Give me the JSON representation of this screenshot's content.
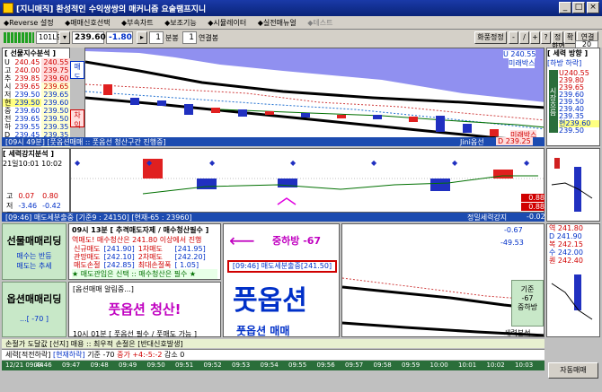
{
  "window": {
    "title": "[지니매직] 환성적인 수익쌍쌍의 매커니즘 요술램프지니"
  },
  "menu": [
    "◆Reverse 설정",
    "◆매매신호선택",
    "◆부속차트",
    "◆보조기능",
    "◆시뮬레이터",
    "◆실전매뉴얼",
    "◆테스트"
  ],
  "toolbar": {
    "code": "101L9",
    "price": "239.60",
    "change": "-1.80",
    "interval": "1",
    "interval_unit": "분봉",
    "count": "1",
    "count_unit": "연결봉",
    "right_buttons": [
      "화풍정정",
      "-",
      "/",
      "+",
      "?",
      "정",
      "확",
      "연결"
    ],
    "screen_label": "화면",
    "screen_num": "20",
    "sub_value": "239.197"
  },
  "futures": {
    "header": "[ 선물지수분석 ]",
    "rows": [
      [
        "U",
        "240.45",
        "240.55"
      ],
      [
        "고",
        "240.00",
        "239.75"
      ],
      [
        "추",
        "239.85",
        "239.60"
      ],
      [
        "시",
        "239.65",
        "239.65"
      ],
      [
        "저",
        "239.50",
        "239.65"
      ],
      [
        "현",
        "239.50",
        "239.60"
      ],
      [
        "중",
        "239.60",
        "239.50"
      ],
      [
        "전",
        "239.65",
        "239.50"
      ],
      [
        "하",
        "239.55",
        "239.35"
      ],
      [
        "D",
        "239.45",
        "239.35"
      ],
      [
        "폭",
        "1.27",
        "1.28"
      ]
    ],
    "side_a": "매",
    "side_b": "도",
    "side_c": "차",
    "side_d": "익"
  },
  "main_chart": {
    "status": "[09시 49분] [풋옵션매매 :: 풋옵선 청산구간 진행중]",
    "right_label": "Jini옵선",
    "right_value": "D 239.25",
    "tag_top": "U 240.55",
    "tag_top2": "미래박스",
    "tag_bot": "미래박스"
  },
  "sub_chart": {
    "header": "[ 세력강지분석 ]",
    "time": "21일10:01",
    "time2": "10:02",
    "rows": [
      [
        "고",
        "0.07",
        "0.80"
      ],
      [
        "저",
        "-3.46",
        "-0.42"
      ],
      [
        "중",
        "-1.00",
        "-0.80"
      ]
    ],
    "status": "[09:46] 매도세분출중 [기준9 : 24150] [현재-65 : 23960]",
    "right_label": "정밀세력강지",
    "right_val1": "0.88",
    "right_val2": "0.88",
    "right_val3": "-0.02"
  },
  "right_panel": {
    "header": "[ 세력 방향 ]",
    "sub": "[하방 하락]",
    "rows": [
      [
        "U",
        "240.55"
      ],
      [
        "",
        "239.80"
      ],
      [
        "",
        "239.65"
      ],
      [
        "",
        "239.60"
      ],
      [
        "",
        "239.50"
      ],
      [
        "",
        "239.40"
      ],
      [
        "",
        "239.35"
      ],
      [
        "현",
        "239.60"
      ],
      [
        "",
        "239.50"
      ]
    ],
    "vlabel": "시장흐름",
    "rows2": [
      [
        "역",
        "241.80"
      ],
      [
        "D",
        "241.90"
      ],
      [
        "복",
        "242.15"
      ],
      [
        "수",
        "242.00"
      ],
      [
        "퀀",
        "242.40"
      ]
    ]
  },
  "signal": {
    "left_title": "선물매매리딩",
    "left_a": "매수는 반등",
    "left_b": "매도는 추세",
    "left2_title": "옵션매매리딩",
    "left2_val": "...[ -70 ]",
    "info_head": "09시 13분 [ 추격매도자제 / 매수청산필수 ]",
    "info1": "역매도! 매수청산은 241.80 이상에서 진행",
    "info_rows": [
      [
        "신규매도",
        "[241.90]",
        "1차매도",
        "[241.95]"
      ],
      [
        "관망매도",
        "[242.10]",
        "2차매도",
        "[242.20]"
      ],
      [
        "매도손절",
        "[242.85]",
        "최대손절폭",
        "[ 1.05]"
      ]
    ],
    "info_note": "★ 매도관입은 신택 :: 매수청산은 필수 ★",
    "arrow_text": "중하방 -67",
    "detail_box": "[09:46] 매도세분출중[241.50]",
    "option_msg": "[옵션매매 알림중...]",
    "option_big": "풋옵션 청산!",
    "option_time": "10시 01분 [ 풋옵선 필수 / 풋매도 가능 ]",
    "big_text": "풋옵션",
    "big_sub": "풋옵션 매매",
    "right_val1": "-0.67",
    "right_val2": "-49.53",
    "right_tag": "기준",
    "right_tag2": "-67",
    "right_tag3": "중하방",
    "bottom_label": "세력분석"
  },
  "status_bar": {
    "line1": "손절가 도달값 [선지] 매용 :: 최우적 손절은 [반대신호발생]",
    "line2_a": "세력[적전하락]",
    "line2_b": "[현재하락]",
    "line2_c": "기준 -70",
    "line2_d": "중가 +4:-5:-2",
    "line2_e": "감소 0",
    "btn": "자동매매"
  },
  "time_axis": [
    "12/21 09:44",
    "09:46",
    "09:47",
    "09:48",
    "09:49",
    "09:50",
    "09:51",
    "09:52",
    "09:53",
    "09:54",
    "09:55",
    "09:56",
    "09:57",
    "09:58",
    "09:59",
    "10:00",
    "10:01",
    "10:02",
    "10:03"
  ],
  "colors": {
    "title_bg": "#1a3aa8",
    "chart_bg": "#ffffff",
    "sky": "#9090f0",
    "bull": "#e02020",
    "bear": "#2030c0"
  }
}
